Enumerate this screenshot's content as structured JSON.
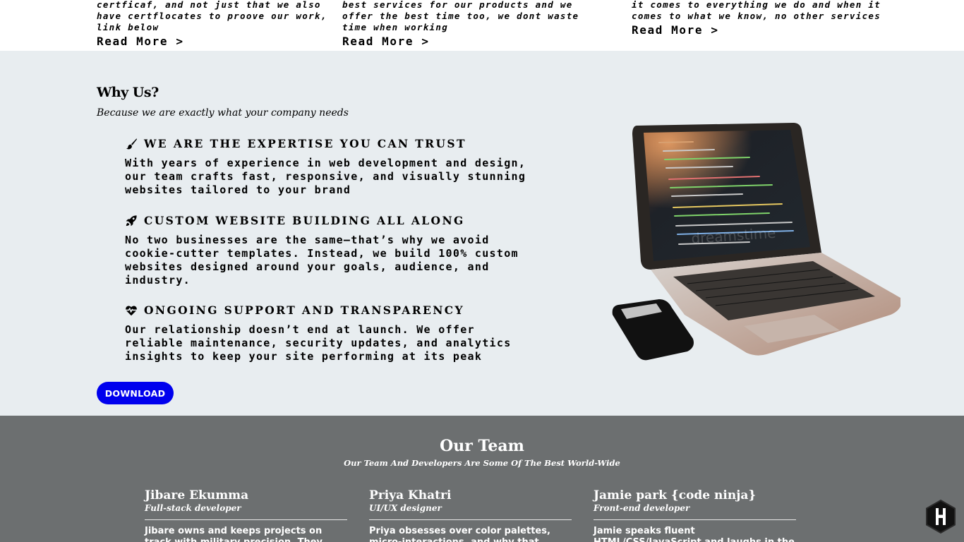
{
  "services": [
    {
      "text": "of study and was also able to gain certficaf, and not just that we also have certflocates to proove our work, link below",
      "read_more": "Read More >"
    },
    {
      "text": "plans as we have them, and we offer the best services for our products and we offer the best time too, we dont waste time when working",
      "read_more": "Read More >"
    },
    {
      "text": "be specifics below, we are the best hen it comes to everything we do and when it comes to what we know, no other services",
      "read_more": "Read More >"
    }
  ],
  "why": {
    "title": "Why Us?",
    "subtitle": "Because we are exactly what your company needs",
    "features": [
      {
        "icon": "paintbrush-icon",
        "title": "WE ARE THE EXPERTISE YOU CAN TRUST",
        "text": "With years of experience in web development and design, our team crafts fast, responsive, and visually stunning websites tailored to your brand"
      },
      {
        "icon": "rocket-icon",
        "title": "CUSTOM WEBSITE BUILDING ALL ALONG",
        "text": "No two businesses are the same—that’s why we avoid cookie-cutter templates. Instead, we build 100% custom websites designed around your goals, audience, and industry."
      },
      {
        "icon": "heart-pulse-icon",
        "title": "ONGOING SUPPORT AND TRANSPARENCY",
        "text": "Our relationship doesn’t end at launch. We offer reliable maintenance, security updates, and analytics insights to keep your site performing at its peak"
      }
    ],
    "button": "DOWNLOAD",
    "image_watermark": "dreamstime"
  },
  "team": {
    "title": "Our Team",
    "subtitle": "Our Team And Developers Are Some Of The Best World-Wide",
    "members": [
      {
        "name": "Jibare Ekumma",
        "role": "Full-stack developer",
        "bio": "Jibare owns and keeps projects on track with military precision. They love"
      },
      {
        "name": "Priya Khatri",
        "role": "UI/UX designer",
        "bio": "Priya obsesses over color palettes, micro-interactions, and why that button feels off."
      },
      {
        "name": "Jamie park {code ninja}",
        "role": "Front-end developer",
        "bio": "Jamie speaks fluent HTML/CSS/JavaScript and laughs in the face of browser"
      }
    ]
  },
  "colors": {
    "why_bg": "#e8edf0",
    "team_bg": "#6c6f70",
    "button_bg": "#0000ee"
  },
  "floating_icon": "hexagon-h-icon"
}
